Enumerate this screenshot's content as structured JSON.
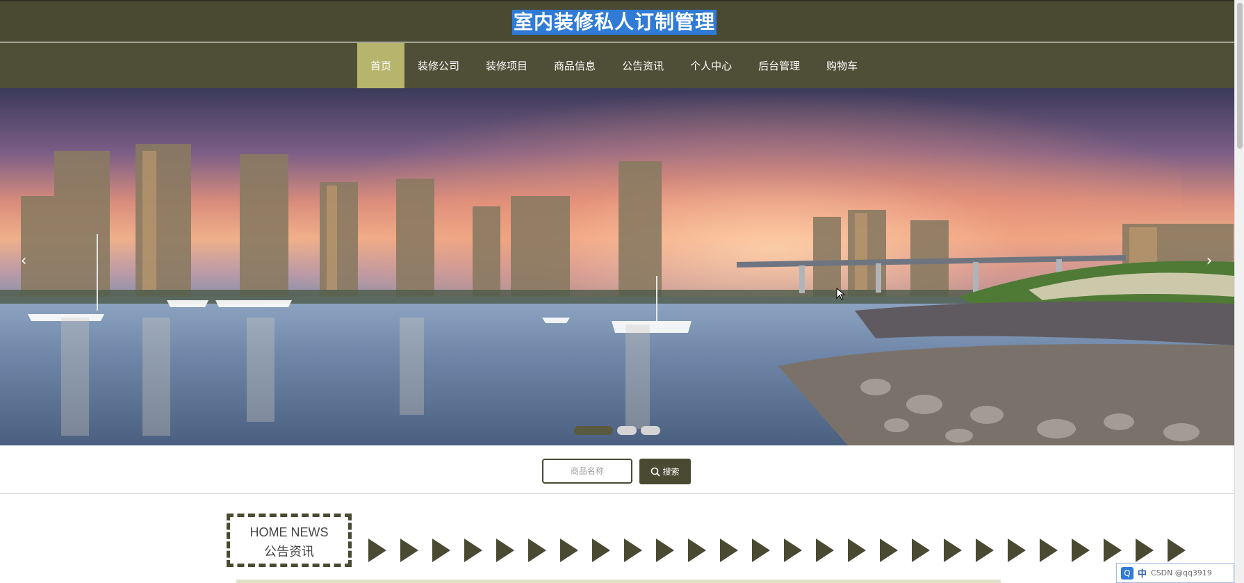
{
  "header": {
    "title": "室内装修私人订制管理"
  },
  "nav": {
    "items": [
      {
        "label": "首页",
        "active": true
      },
      {
        "label": "装修公司",
        "active": false
      },
      {
        "label": "装修项目",
        "active": false
      },
      {
        "label": "商品信息",
        "active": false
      },
      {
        "label": "公告资讯",
        "active": false
      },
      {
        "label": "个人中心",
        "active": false
      },
      {
        "label": "后台管理",
        "active": false
      },
      {
        "label": "购物车",
        "active": false
      }
    ]
  },
  "banner": {
    "prev_icon": "chevron-left-icon",
    "next_icon": "chevron-right-icon",
    "slide_count": 3,
    "active_slide": 1
  },
  "search": {
    "placeholder": "商品名称",
    "button_label": "搜索",
    "button_icon": "search-icon"
  },
  "news": {
    "title_en": "HOME NEWS",
    "title_cn": "公告资讯"
  },
  "ime": {
    "mode": "中",
    "watermark": "CSDN @qq3919"
  },
  "colors": {
    "header_bg": "#4a4a33",
    "nav_active": "#b7b56d",
    "title_highlight": "#2f7bd6"
  }
}
